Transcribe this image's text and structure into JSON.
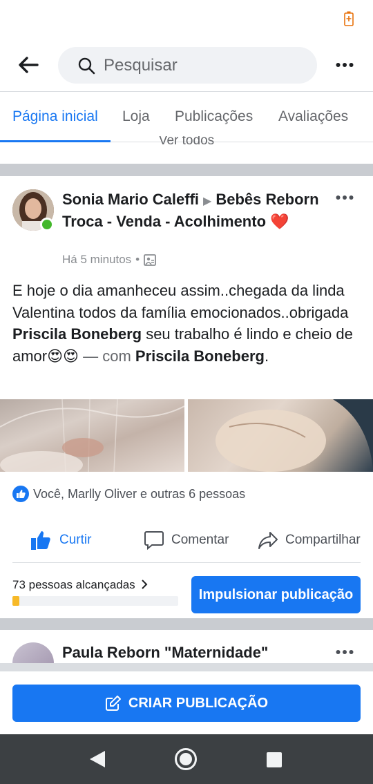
{
  "search": {
    "placeholder": "Pesquisar"
  },
  "tabs": [
    {
      "label": "Página inicial",
      "active": true
    },
    {
      "label": "Loja"
    },
    {
      "label": "Publicações"
    },
    {
      "label": "Avaliações"
    }
  ],
  "see_all": "Ver todos",
  "post": {
    "author": "Sonia Mario Caleffi",
    "group": "Bebês Reborn Troca - Venda - Acolhimento",
    "group_emoji": "❤️",
    "time": "Há 5 minutos",
    "dot": "•",
    "text_1": "E hoje o dia amanheceu assim..chegada da linda Valentina todos da família emocionados..obrigada ",
    "mention_1": "Priscila Boneberg",
    "text_2": " seu trabalho é lindo e cheio de amor",
    "emojis": "😍😍",
    "with_text": " — com ",
    "mention_2": "Priscila Boneberg",
    "end": ".",
    "reactions": "Você, Marlly Oliver e outras 6 pessoas",
    "actions": {
      "like": "Curtir",
      "comment": "Comentar",
      "share": "Compartilhar"
    },
    "reach": "73 pessoas alcançadas",
    "reach_level": 0.04,
    "boost": "Impulsionar publicação"
  },
  "post2": {
    "author": "Paula Reborn \"Maternidade\""
  },
  "create_post": "CRIAR PUBLICAÇÃO",
  "colors": {
    "accent": "#1877f2",
    "online": "#42b72a",
    "reach_fill": "#f7b928"
  }
}
